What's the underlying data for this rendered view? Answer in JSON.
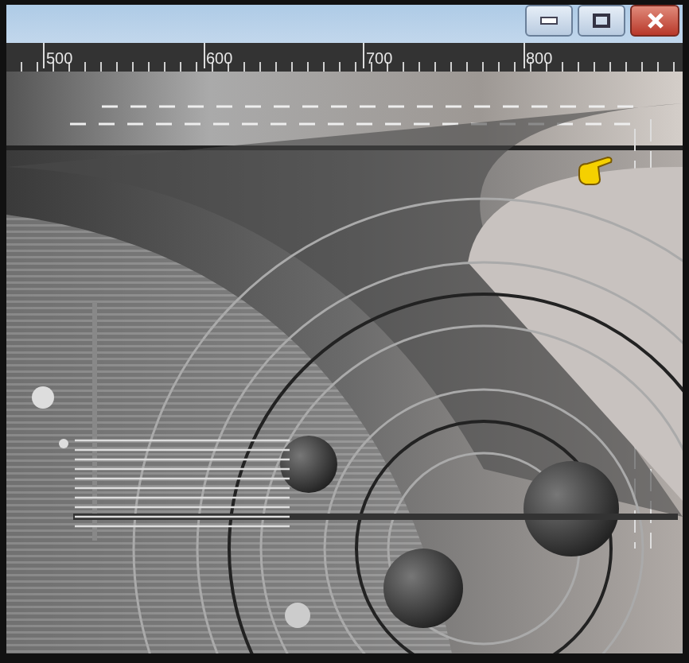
{
  "window": {
    "controls": [
      {
        "kind": "minimize"
      },
      {
        "kind": "maximize"
      },
      {
        "kind": "close"
      }
    ]
  },
  "ruler": {
    "labels": [
      "500",
      "600",
      "700",
      "800"
    ]
  }
}
